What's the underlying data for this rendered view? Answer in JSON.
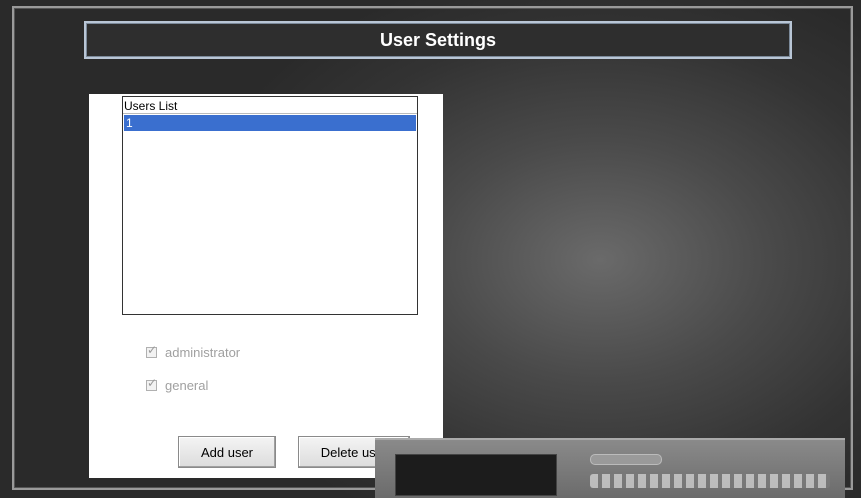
{
  "window": {
    "title": "User Settings"
  },
  "users_list": {
    "header": "Users List",
    "items": [
      "1"
    ],
    "selected_index": 0
  },
  "permissions": [
    {
      "label": "administrator",
      "checked": true,
      "enabled": false
    },
    {
      "label": "general",
      "checked": true,
      "enabled": false
    }
  ],
  "buttons": {
    "add_user": "Add user",
    "delete_user": "Delete user"
  },
  "colors": {
    "selection": "#3a6fcf",
    "title_border": "#b9c6d6",
    "disabled_text": "#a0a0a0"
  },
  "icons": {
    "checkbox_mark": "check-icon"
  }
}
